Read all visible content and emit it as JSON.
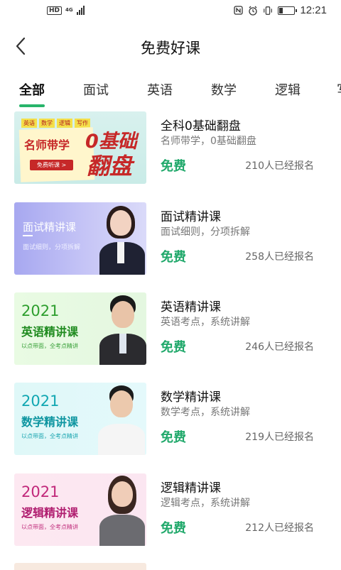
{
  "status_bar": {
    "hd": "HD",
    "network": "4G",
    "time": "12:21",
    "icons": [
      "nfc-icon",
      "alarm-icon",
      "vibrate-icon",
      "battery-icon"
    ]
  },
  "header": {
    "title": "免费好课",
    "back_icon": "chevron-left-icon"
  },
  "tabs": [
    {
      "label": "全部",
      "active": true
    },
    {
      "label": "面试",
      "active": false
    },
    {
      "label": "英语",
      "active": false
    },
    {
      "label": "数学",
      "active": false
    },
    {
      "label": "逻辑",
      "active": false
    },
    {
      "label": "写",
      "active": false
    }
  ],
  "colors": {
    "accent": "#27b46a",
    "free_text": "#1fa86a"
  },
  "courses": [
    {
      "title": "全科0基础翻盘",
      "subtitle": "名师带学，0基础翻盘",
      "price": "免费",
      "enrolled": "210人已经报名",
      "thumb": {
        "tags": [
          "英语",
          "数学",
          "逻辑",
          "写作"
        ],
        "line1": "名师带学",
        "button": "免费听课 >",
        "big1": "0基础",
        "big2": "翻盘"
      }
    },
    {
      "title": "面试精讲课",
      "subtitle": "面试细则，分项拆解",
      "price": "免费",
      "enrolled": "258人已经报名",
      "thumb": {
        "line1": "面试精讲课",
        "line2": "面试细则，分项拆解"
      }
    },
    {
      "title": "英语精讲课",
      "subtitle": "英语考点，系统讲解",
      "price": "免费",
      "enrolled": "246人已经报名",
      "thumb": {
        "year": "2021",
        "name": "英语精讲课",
        "small": "以点带面，全考点精讲"
      }
    },
    {
      "title": "数学精讲课",
      "subtitle": "数学考点，系统讲解",
      "price": "免费",
      "enrolled": "219人已经报名",
      "thumb": {
        "year": "2021",
        "name": "数学精讲课",
        "small": "以点带面，全考点精讲"
      }
    },
    {
      "title": "逻辑精讲课",
      "subtitle": "逻辑考点，系统讲解",
      "price": "免费",
      "enrolled": "212人已经报名",
      "thumb": {
        "year": "2021",
        "name": "逻辑精讲课",
        "small": "以点带面，全考点精讲"
      }
    }
  ]
}
